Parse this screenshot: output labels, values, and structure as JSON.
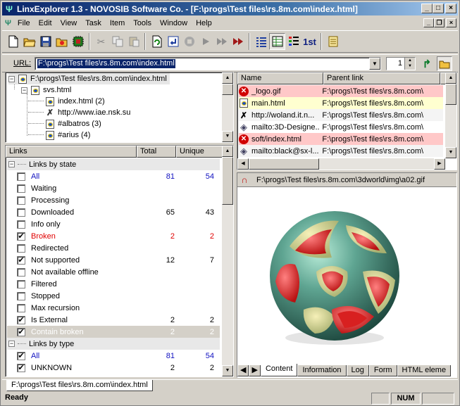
{
  "window": {
    "title": "LinxExplorer 1.3 - NOVOSIB Software Co. - [F:\\progs\\Test files\\rs.8m.com\\index.html]"
  },
  "menu": {
    "items": [
      "File",
      "Edit",
      "View",
      "Task",
      "Item",
      "Tools",
      "Window",
      "Help"
    ]
  },
  "url": {
    "label": "URL:",
    "value": "F:\\progs\\Test files\\rs.8m.com\\index.html",
    "depth": "1"
  },
  "tree": {
    "items": [
      {
        "text": "F:\\progs\\Test files\\rs.8m.com\\index.html",
        "icon": "page-icon",
        "toggle": "−"
      },
      {
        "text": "svs.html",
        "icon": "page-icon",
        "toggle": "−"
      },
      {
        "text": "index.html (2)",
        "icon": "page-icon"
      },
      {
        "text": "http://www.iae.nsk.su",
        "icon": "cross-link-icon"
      },
      {
        "text": "#albatros (3)",
        "icon": "page-icon"
      },
      {
        "text": "#arius (4)",
        "icon": "page-icon"
      }
    ]
  },
  "links": {
    "headers": {
      "name": "Links",
      "total": "Total",
      "unique": "Unique"
    },
    "rows": [
      {
        "label": "Links by state",
        "group": true
      },
      {
        "label": "All",
        "checked": false,
        "total": "81",
        "unique": "54",
        "color": "blue"
      },
      {
        "label": "Waiting",
        "checked": false
      },
      {
        "label": "Processing",
        "checked": false
      },
      {
        "label": "Downloaded",
        "checked": false,
        "total": "65",
        "unique": "43"
      },
      {
        "label": "Info only",
        "checked": false
      },
      {
        "label": "Broken",
        "checked": true,
        "total": "2",
        "unique": "2",
        "color": "red"
      },
      {
        "label": "Redirected",
        "checked": false
      },
      {
        "label": "Not supported",
        "checked": true,
        "total": "12",
        "unique": "7"
      },
      {
        "label": "Not available offline",
        "checked": false
      },
      {
        "label": "Filtered",
        "checked": false
      },
      {
        "label": "Stopped",
        "checked": false
      },
      {
        "label": "Max recursion",
        "checked": false
      },
      {
        "label": "Is External",
        "checked": true,
        "total": "2",
        "unique": "2"
      },
      {
        "label": "Contain broken",
        "checked": true,
        "total": "2",
        "unique": "2",
        "selected": true
      },
      {
        "label": "Links by type",
        "group": true
      },
      {
        "label": "All",
        "checked": true,
        "total": "81",
        "unique": "54",
        "color": "blue"
      },
      {
        "label": "UNKNOWN",
        "checked": true,
        "total": "2",
        "unique": "2"
      }
    ]
  },
  "files": {
    "headers": {
      "name": "Name",
      "parent": "Parent link"
    },
    "rows": [
      {
        "name": "_logo.gif",
        "parent": "F:\\progs\\Test files\\rs.8m.com\\",
        "icon": "error-icon",
        "bg": "#ffc8c8"
      },
      {
        "name": "main.html",
        "parent": "F:\\progs\\Test files\\rs.8m.com\\",
        "icon": "page-icon",
        "bg": "#ffffd0"
      },
      {
        "name": "http://woland.it.n...",
        "parent": "F:\\progs\\Test files\\rs.8m.com\\",
        "icon": "cross-link-icon",
        "bg": "#f4f4f4"
      },
      {
        "name": "mailto:3D-Designe...",
        "parent": "F:\\progs\\Test files\\rs.8m.com\\",
        "icon": "mail-icon",
        "bg": "#ffffff"
      },
      {
        "name": "soft/index.html",
        "parent": "F:\\progs\\Test files\\rs.8m.com\\",
        "icon": "error-icon",
        "bg": "#ffc8c8"
      },
      {
        "name": "mailto:black@sx-l...",
        "parent": "F:\\progs\\Test files\\rs.8m.com\\",
        "icon": "mail-icon",
        "bg": "#f4f4f4"
      }
    ]
  },
  "preview": {
    "path": "F:\\progs\\Test files\\rs.8m.com\\3dworld\\img\\a02.gif",
    "tabs": [
      "Content",
      "Information",
      "Log",
      "Form",
      "HTML eleme"
    ]
  },
  "doc_tab": {
    "label": "F:\\progs\\Test files\\rs.8m.com\\index.html"
  },
  "status": {
    "text": "Ready",
    "num": "NUM"
  }
}
